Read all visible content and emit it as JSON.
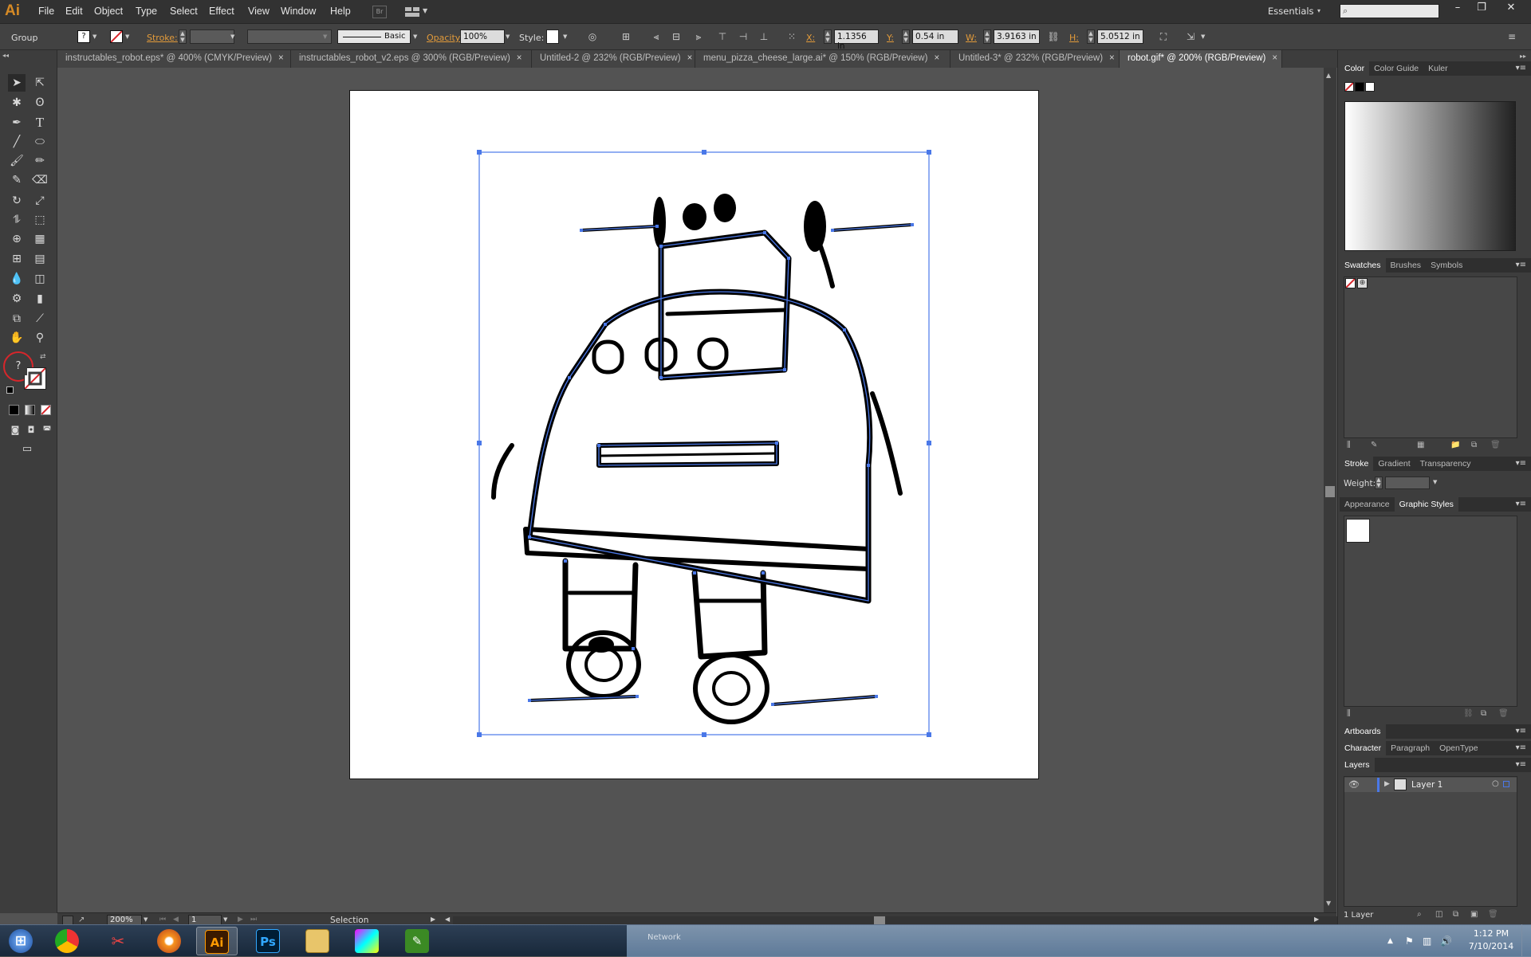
{
  "app": {
    "logo": "Ai",
    "menu": [
      "File",
      "Edit",
      "Object",
      "Type",
      "Select",
      "Effect",
      "View",
      "Window",
      "Help"
    ],
    "bridge_label": "Br",
    "workspace": "Essentials",
    "window_buttons": [
      "–",
      "❐",
      "✕"
    ]
  },
  "control_bar": {
    "selection_type": "Group",
    "fill_swatch": "?",
    "stroke_label": "Stroke:",
    "brush_label": "Basic",
    "opacity_label": "Opacity:",
    "opacity_value": "100%",
    "style_label": "Style:",
    "x_label": "X:",
    "x_value": "1.1356 in",
    "y_label": "Y:",
    "y_value": "0.54 in",
    "w_label": "W:",
    "w_value": "3.9163 in",
    "h_label": "H:",
    "h_value": "5.0512 in"
  },
  "tabs": [
    {
      "label": "instructables_robot.eps* @ 400% (CMYK/Preview)",
      "active": false
    },
    {
      "label": "instructables_robot_v2.eps @ 300% (RGB/Preview)",
      "active": false
    },
    {
      "label": "Untitled-2 @ 232% (RGB/Preview)",
      "active": false
    },
    {
      "label": "menu_pizza_cheese_large.ai* @ 150% (RGB/Preview)",
      "active": false
    },
    {
      "label": "Untitled-3* @ 232% (RGB/Preview)",
      "active": false
    },
    {
      "label": "robot.gif* @ 200% (RGB/Preview)",
      "active": true
    }
  ],
  "tab_close": "×",
  "toolbox": {
    "help_glyph": "?"
  },
  "status": {
    "zoom": "200%",
    "artboard_number": "1",
    "tool": "Selection"
  },
  "panels": {
    "color_tabs": [
      "Color",
      "Color Guide",
      "Kuler"
    ],
    "swatch_tabs": [
      "Swatches",
      "Brushes",
      "Symbols"
    ],
    "stroke_tabs": [
      "Stroke",
      "Gradient",
      "Transparency"
    ],
    "stroke_weight_label": "Weight:",
    "appearance_tabs": [
      "Appearance",
      "Graphic Styles"
    ],
    "artboards_tab": "Artboards",
    "character_tabs": [
      "Character",
      "Paragraph",
      "OpenType"
    ],
    "layers_tab": "Layers",
    "layer_name": "Layer 1",
    "layers_count": "1 Layer"
  },
  "taskbar": {
    "network_label": "Network",
    "time": "1:12 PM",
    "date": "7/10/2014",
    "app_icons": [
      "start-icon",
      "chrome-icon",
      "snipping-tool-icon",
      "firefox-icon",
      "illustrator-icon",
      "photoshop-icon",
      "file-explorer-icon",
      "color-app-icon",
      "green-app-icon"
    ]
  },
  "colors": {
    "selection_blue": "#4a78e8",
    "ai_orange": "#d68a25",
    "chrome_bg": "#323232",
    "highlight_red": "#d7262b"
  }
}
